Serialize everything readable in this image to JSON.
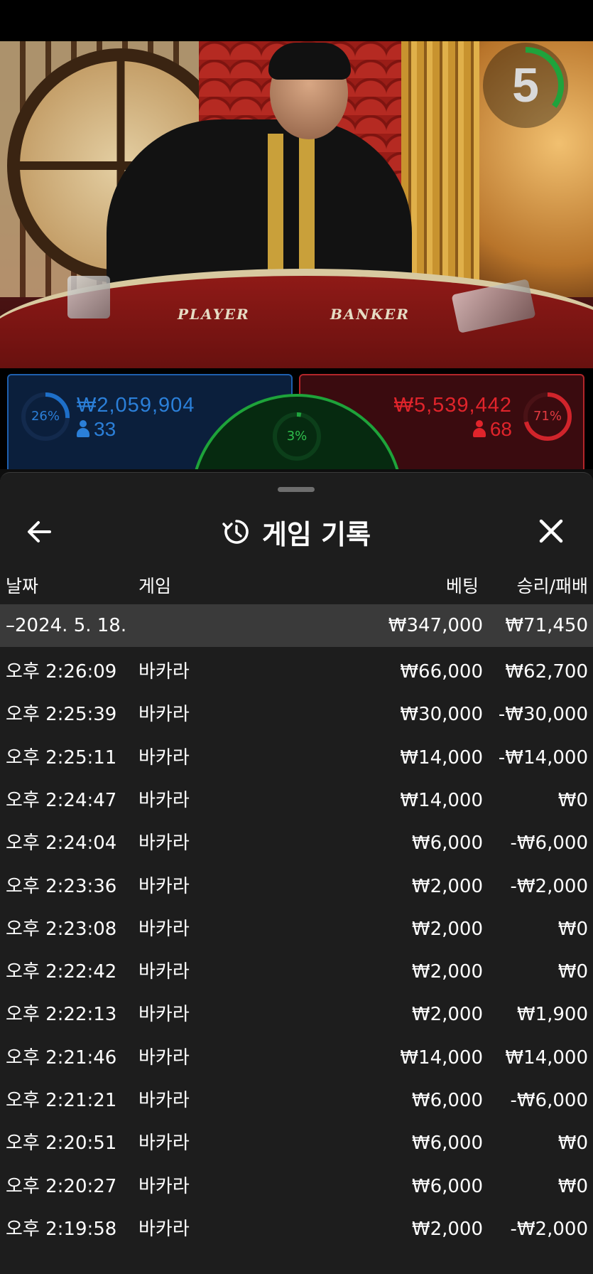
{
  "timer": {
    "value": "5",
    "progress": 0.35,
    "color": "#1fa33c"
  },
  "table_labels": {
    "player": "PLAYER",
    "banker": "BANKER"
  },
  "player": {
    "percent": "26%",
    "percent_value": 0.26,
    "amount": "₩2,059,904",
    "count": "33",
    "color": "#1e6fc8"
  },
  "banker": {
    "percent": "71%",
    "percent_value": 0.71,
    "amount": "₩5,539,442",
    "count": "68",
    "color": "#d0242b"
  },
  "tie": {
    "percent": "3%",
    "percent_value": 0.03,
    "color": "#1fa33c"
  },
  "sheet": {
    "title": "게임 기록",
    "columns": {
      "date": "날짜",
      "game": "게임",
      "bet": "베팅",
      "result": "승리/패배"
    },
    "day": {
      "date": "–2024. 5. 18.",
      "bet": "₩347,000",
      "result": "₩71,450"
    },
    "rows": [
      {
        "time": "오후 2:26:09",
        "game": "바카라",
        "bet": "₩66,000",
        "result": "₩62,700"
      },
      {
        "time": "오후 2:25:39",
        "game": "바카라",
        "bet": "₩30,000",
        "result": "-₩30,000"
      },
      {
        "time": "오후 2:25:11",
        "game": "바카라",
        "bet": "₩14,000",
        "result": "-₩14,000"
      },
      {
        "time": "오후 2:24:47",
        "game": "바카라",
        "bet": "₩14,000",
        "result": "₩0"
      },
      {
        "time": "오후 2:24:04",
        "game": "바카라",
        "bet": "₩6,000",
        "result": "-₩6,000"
      },
      {
        "time": "오후 2:23:36",
        "game": "바카라",
        "bet": "₩2,000",
        "result": "-₩2,000"
      },
      {
        "time": "오후 2:23:08",
        "game": "바카라",
        "bet": "₩2,000",
        "result": "₩0"
      },
      {
        "time": "오후 2:22:42",
        "game": "바카라",
        "bet": "₩2,000",
        "result": "₩0"
      },
      {
        "time": "오후 2:22:13",
        "game": "바카라",
        "bet": "₩2,000",
        "result": "₩1,900"
      },
      {
        "time": "오후 2:21:46",
        "game": "바카라",
        "bet": "₩14,000",
        "result": "₩14,000"
      },
      {
        "time": "오후 2:21:21",
        "game": "바카라",
        "bet": "₩6,000",
        "result": "-₩6,000"
      },
      {
        "time": "오후 2:20:51",
        "game": "바카라",
        "bet": "₩6,000",
        "result": "₩0"
      },
      {
        "time": "오후 2:20:27",
        "game": "바카라",
        "bet": "₩6,000",
        "result": "₩0"
      },
      {
        "time": "오후 2:19:58",
        "game": "바카라",
        "bet": "₩2,000",
        "result": "-₩2,000"
      }
    ]
  },
  "icons": {
    "back": "arrow-left-icon",
    "close": "close-icon",
    "history": "history-icon",
    "person": "person-icon"
  }
}
